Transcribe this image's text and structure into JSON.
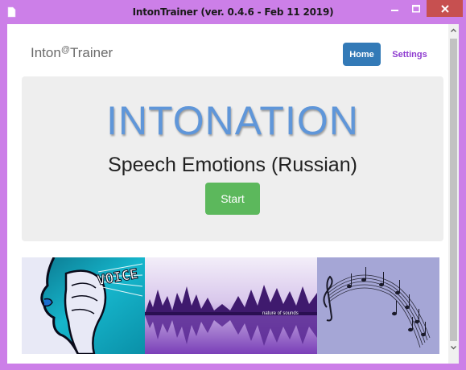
{
  "window": {
    "title": "IntonTrainer (ver. 0.4.6 - Feb 11 2019)",
    "frame_color": "#cc7fe8",
    "close_color": "#c75050"
  },
  "nav": {
    "brand_main": "Inton",
    "brand_sup": "@",
    "brand_end": "Trainer",
    "home_label": "Home",
    "settings_label": "Settings"
  },
  "hero": {
    "title": "INTONATION",
    "subtitle": "Speech Emotions (Russian)",
    "start_label": "Start",
    "title_color": "#5f96d9",
    "start_color": "#5cb85c"
  },
  "images": {
    "voice_text": "VOICE",
    "nature_caption": "nature of sounds"
  },
  "icons": [
    "app-icon",
    "minimize-icon",
    "maximize-icon",
    "close-icon",
    "scroll-up-icon",
    "scroll-down-icon"
  ]
}
